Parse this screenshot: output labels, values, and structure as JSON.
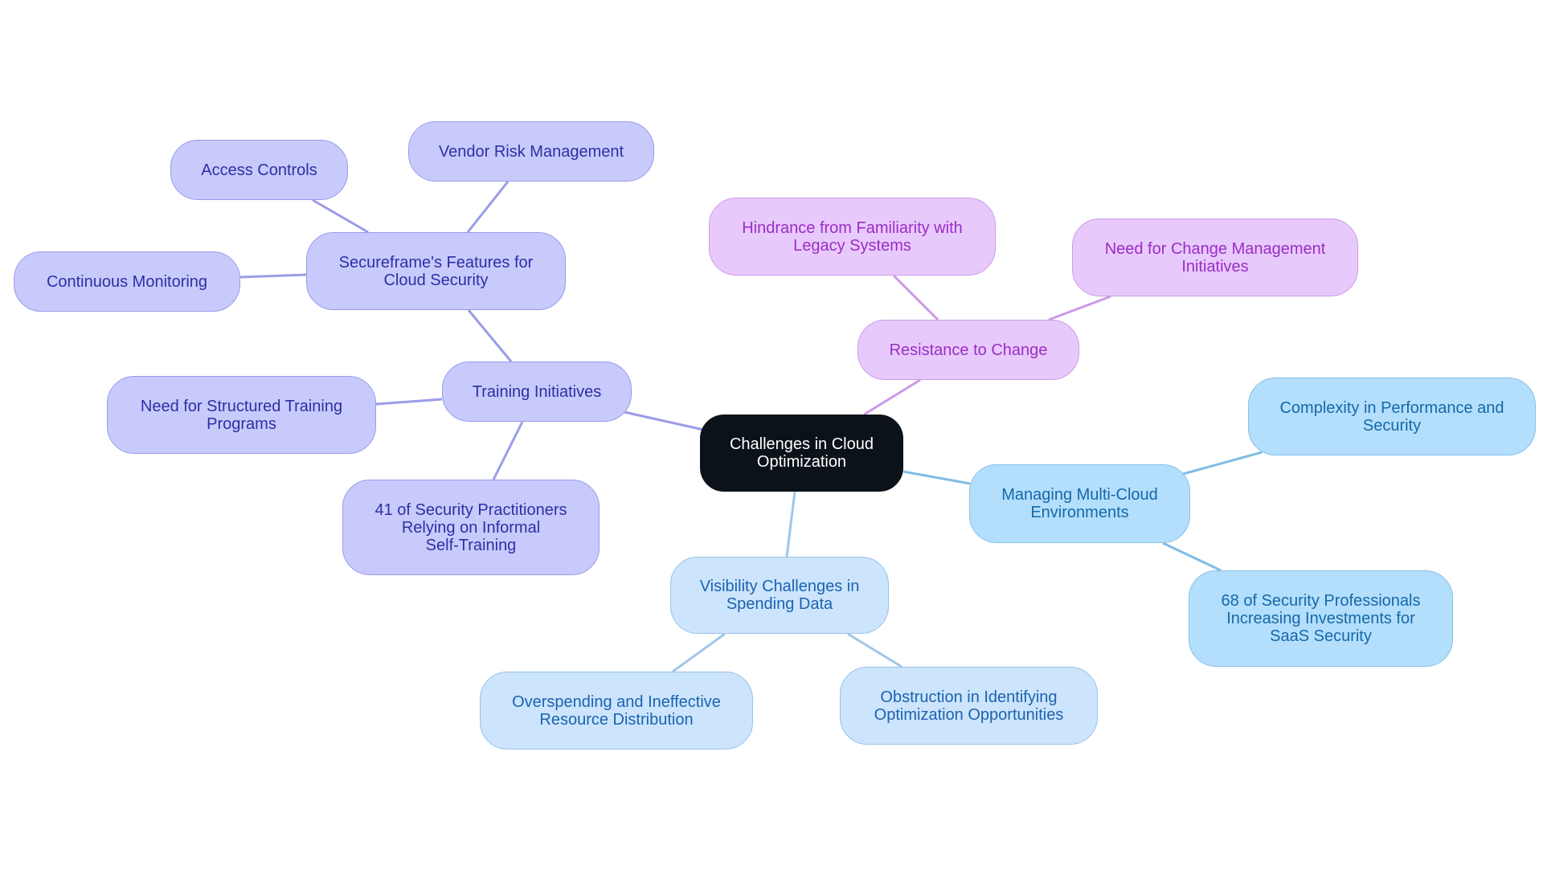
{
  "diagram": {
    "type": "mindmap",
    "colors": {
      "root_fill": "#0c1219",
      "root_text": "#ffffff",
      "indigo_fill": "#c8cafc",
      "indigo_text": "#2e2fa3",
      "indigo_edge": "#9a9ce8",
      "violet_fill": "#e8c9fc",
      "violet_text": "#9a2dc4",
      "violet_edge": "#cc9ae8",
      "sky_fill": "#b3defc",
      "sky_text": "#1569a8",
      "sky_edge": "#7fbde6",
      "pale_fill": "#cce4fc",
      "pale_text": "#1b63b0",
      "pale_edge": "#9fc6ea"
    },
    "nodes": {
      "root": "Challenges in Cloud\nOptimization",
      "training": "Training Initiatives",
      "secureframe": "Secureframe's Features for\nCloud Security",
      "access": "Access Controls",
      "vendor": "Vendor Risk Management",
      "monitoring": "Continuous Monitoring",
      "structured": "Need for Structured Training\nPrograms",
      "practitioners": "41 of Security Practitioners\nRelying on Informal\nSelf-Training",
      "resistance": "Resistance to Change",
      "hindrance": "Hindrance from Familiarity with\nLegacy Systems",
      "changemgmt": "Need for Change Management\nInitiatives",
      "multicloud": "Managing Multi-Cloud\nEnvironments",
      "complexity": "Complexity in Performance and\nSecurity",
      "professionals": "68 of Security Professionals\nIncreasing Investments for\nSaaS Security",
      "visibility": "Visibility Challenges in\nSpending Data",
      "overspending": "Overspending and Ineffective\nResource Distribution",
      "obstruction": "Obstruction in Identifying\nOptimization Opportunities"
    },
    "edges": [
      [
        "root",
        "training"
      ],
      [
        "training",
        "secureframe"
      ],
      [
        "secureframe",
        "access"
      ],
      [
        "secureframe",
        "vendor"
      ],
      [
        "secureframe",
        "monitoring"
      ],
      [
        "training",
        "structured"
      ],
      [
        "training",
        "practitioners"
      ],
      [
        "root",
        "resistance"
      ],
      [
        "resistance",
        "hindrance"
      ],
      [
        "resistance",
        "changemgmt"
      ],
      [
        "root",
        "multicloud"
      ],
      [
        "multicloud",
        "complexity"
      ],
      [
        "multicloud",
        "professionals"
      ],
      [
        "root",
        "visibility"
      ],
      [
        "visibility",
        "overspending"
      ],
      [
        "visibility",
        "obstruction"
      ]
    ]
  }
}
